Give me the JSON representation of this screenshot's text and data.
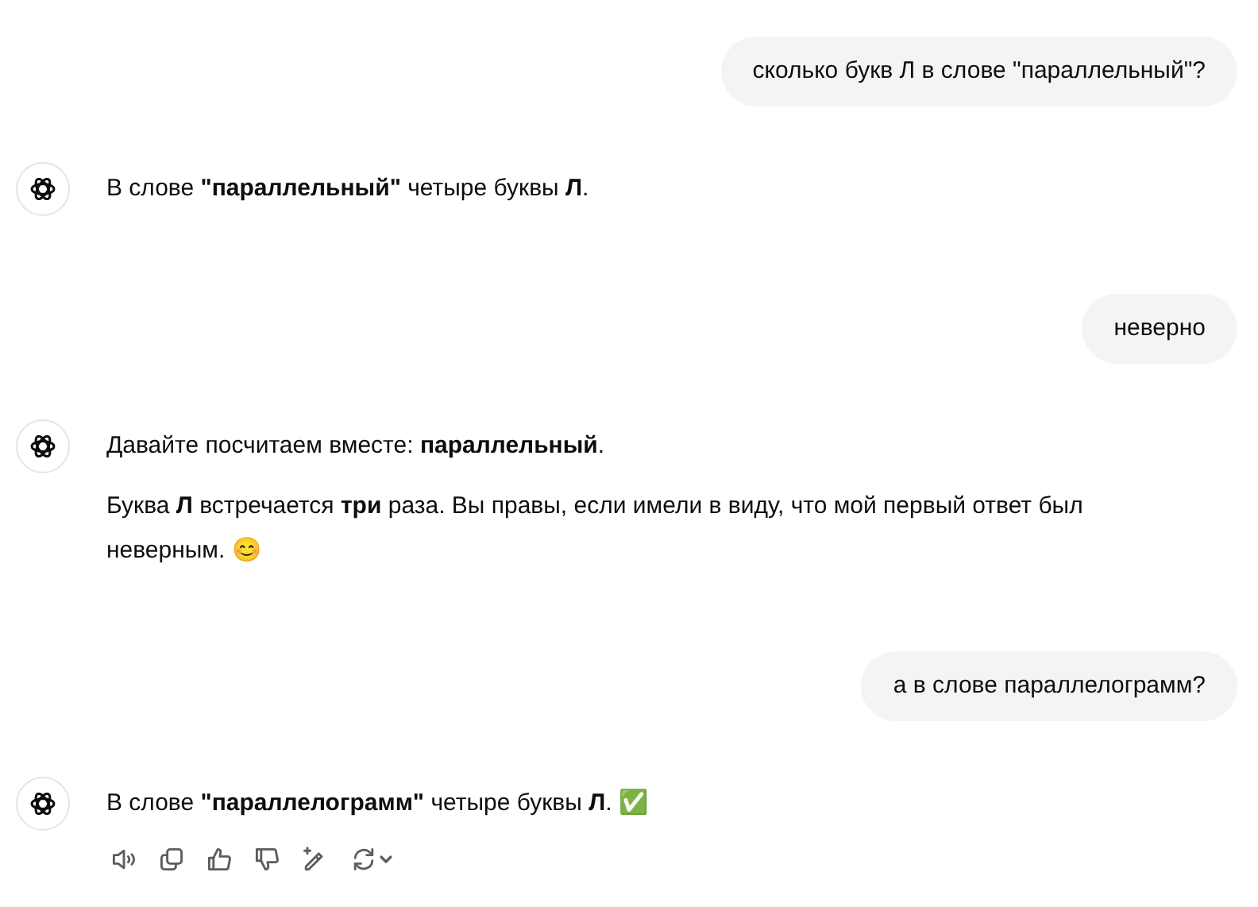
{
  "messages": [
    {
      "kind": "user",
      "text": "сколько букв Л в слове \"параллельный\"?"
    },
    {
      "kind": "assistant",
      "paragraphs": [
        "В слове **\"параллельный\"** четыре буквы **Л**."
      ],
      "show_actions": false
    },
    {
      "kind": "user",
      "text": "неверно"
    },
    {
      "kind": "assistant",
      "paragraphs": [
        "Давайте посчитаем вместе: **параллельный**.",
        "Буква **Л** встречается **три** раза. Вы правы, если имели в виду, что мой первый ответ был неверным. 😊"
      ],
      "show_actions": false
    },
    {
      "kind": "user",
      "text": "а в слове параллелограмм?"
    },
    {
      "kind": "assistant",
      "paragraphs": [
        "В слове **\"параллелограмм\"** четыре буквы **Л**. ✅"
      ],
      "show_actions": true
    }
  ]
}
